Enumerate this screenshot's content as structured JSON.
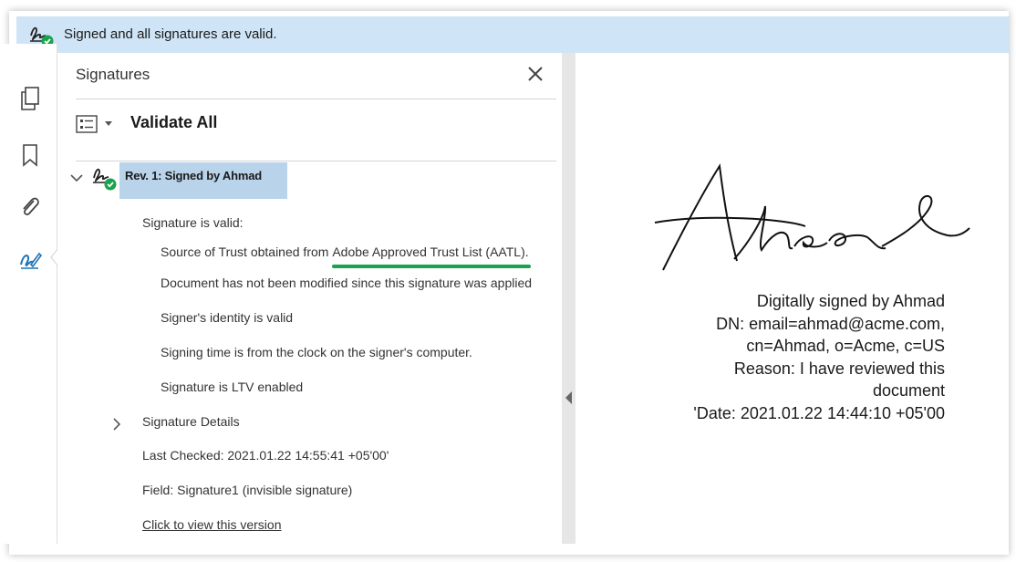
{
  "status_bar": {
    "text": "Signed and all signatures are valid."
  },
  "left_rail": {
    "icons": [
      "pages-icon",
      "bookmark-icon",
      "attachment-icon",
      "signature-pen-icon"
    ],
    "active": "signature-pen-icon"
  },
  "panel": {
    "title": "Signatures",
    "validate_label": "Validate All",
    "revision": {
      "label": "Rev. 1: Signed by Ahmad",
      "status_header": "Signature is valid:",
      "details": {
        "trust_prefix": "Source of Trust obtained from ",
        "trust_source": "Adobe Approved Trust List (AATL).",
        "not_modified": "Document has not been modified since this signature was applied",
        "identity": "Signer's identity is valid",
        "signing_time": "Signing time is from the clock on the signer's computer.",
        "ltv": "Signature is LTV enabled"
      },
      "signature_details": "Signature Details",
      "last_checked": "Last Checked: 2021.01.22 14:55:41 +05'00'",
      "field": "Field: Signature1 (invisible signature)",
      "view_version_link": "Click to view this version"
    }
  },
  "document": {
    "signature_lines": [
      "Digitally signed by Ahmad",
      "DN: email=ahmad@acme.com,",
      "cn=Ahmad, o=Acme, c=US",
      "Reason: I have reviewed this",
      "document",
      "'Date: 2021.01.22 14:44:10 +05'00"
    ]
  },
  "colors": {
    "status_bar_bg": "#cfe5f7",
    "valid_green": "#1aa24f",
    "selection_bg": "#b9d3ea",
    "active_icon_blue": "#1f73b7"
  }
}
